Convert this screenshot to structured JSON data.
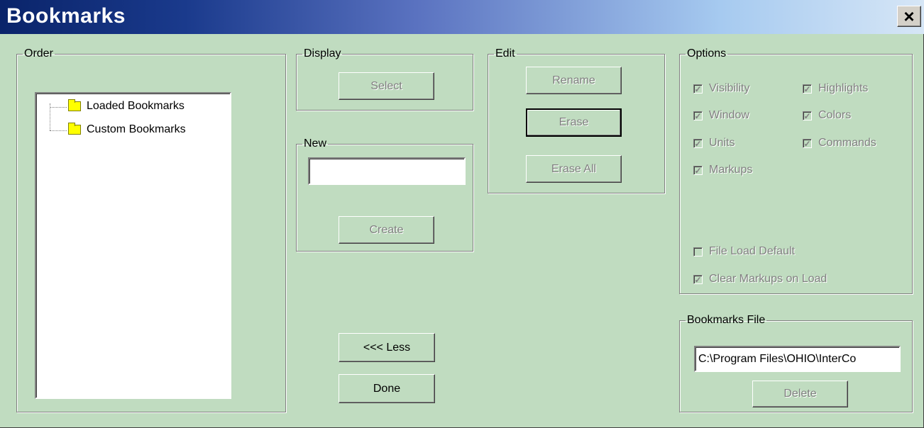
{
  "window": {
    "title": "Bookmarks",
    "close_glyph": "×",
    "background": "#c0dcc0"
  },
  "order": {
    "label": "Order",
    "tree": [
      {
        "label": "Loaded Bookmarks",
        "icon": "folder-icon"
      },
      {
        "label": "Custom Bookmarks",
        "icon": "folder-icon"
      }
    ]
  },
  "display": {
    "label": "Display",
    "select_button": "Select"
  },
  "new": {
    "label": "New",
    "name_value": "",
    "create_button": "Create"
  },
  "edit": {
    "label": "Edit",
    "rename_button": "Rename",
    "erase_button": "Erase",
    "erase_all_button": "Erase All"
  },
  "options": {
    "label": "Options",
    "items": [
      {
        "label": "Visibility",
        "checked": true
      },
      {
        "label": "Highlights",
        "checked": true
      },
      {
        "label": "Window",
        "checked": true
      },
      {
        "label": "Colors",
        "checked": true
      },
      {
        "label": "Units",
        "checked": true
      },
      {
        "label": "Commands",
        "checked": true
      },
      {
        "label": "Markups",
        "checked": true
      },
      {
        "label": "File Load Default",
        "checked": false
      },
      {
        "label": "Clear Markups on Load",
        "checked": true
      }
    ]
  },
  "bookmarks_file": {
    "label": "Bookmarks File",
    "path": "C:\\Program Files\\OHIO\\InterCo",
    "delete_button": "Delete"
  },
  "buttons": {
    "less": "<<< Less",
    "done": "Done"
  }
}
